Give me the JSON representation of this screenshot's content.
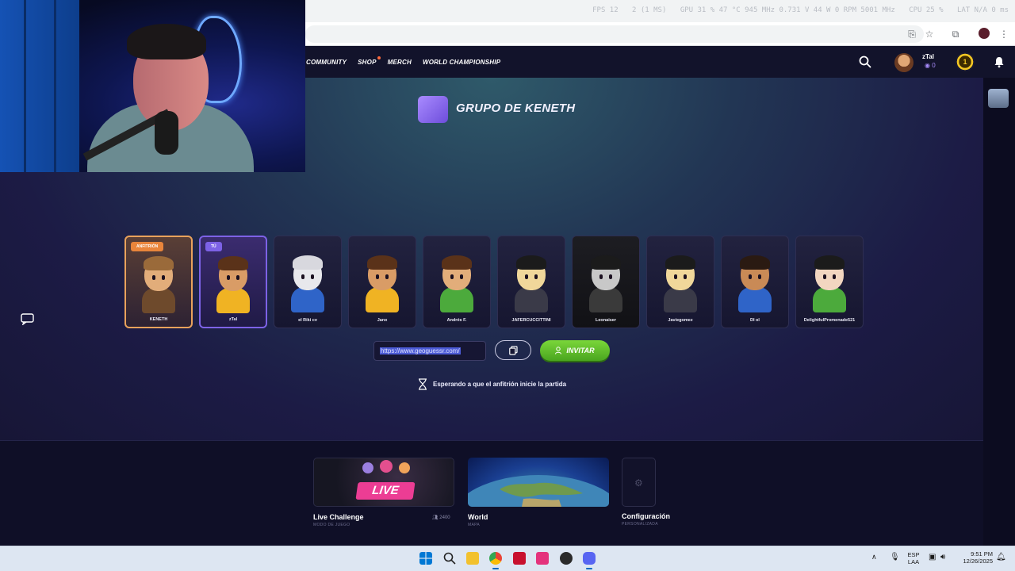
{
  "overlay": {
    "fps": "FPS  12",
    "fps_ms": "2 (1 MS)",
    "gpu": "GPU  31 %  47 °C  945 MHz  0.731 V  44 W  0 RPM  5001 MHz",
    "cpu": "CPU  25 %",
    "lat": "LAT  N/A  0 ms"
  },
  "browser": {
    "icons": [
      "cast-icon",
      "star-icon",
      "extensions-icon",
      "profile-avatar",
      "menu-icon"
    ]
  },
  "nav": {
    "links": [
      {
        "label": "COMMUNITY",
        "notify": false
      },
      {
        "label": "SHOP",
        "notify": true
      },
      {
        "label": "MERCH",
        "notify": false
      },
      {
        "label": "WORLD CHAMPIONSHIP",
        "notify": false
      }
    ],
    "username": "zTal",
    "coins": "0",
    "level": "1"
  },
  "lobby": {
    "title": "GRUPO DE KENETH",
    "players": [
      {
        "name": "KENETH",
        "badge": "ANFITRIÓN",
        "role": "host",
        "shirt": "#6e4a2c",
        "hair": "#9a6a3a",
        "skin": "#e2ad7a"
      },
      {
        "name": "zTal",
        "badge": "TÚ",
        "role": "me",
        "shirt": "#f0b323",
        "hair": "#5a3219",
        "skin": "#d99c66"
      },
      {
        "name": "el Riki cv",
        "badge": "",
        "role": "",
        "shirt": "#2f64c8",
        "hair": "#d8d8de",
        "skin": "#e8e8ec"
      },
      {
        "name": "Janx",
        "badge": "",
        "role": "",
        "shirt": "#f0b323",
        "hair": "#5a3219",
        "skin": "#d99c66"
      },
      {
        "name": "Andrés F.",
        "badge": "",
        "role": "",
        "shirt": "#4caa3c",
        "hair": "#5a3219",
        "skin": "#e2ad7a"
      },
      {
        "name": "JAFERCUCCITTINI",
        "badge": "",
        "role": "",
        "shirt": "#3a3a48",
        "hair": "#1b1b1b",
        "skin": "#f0d79a"
      },
      {
        "name": "Leonaiser",
        "badge": "",
        "role": "dim",
        "shirt": "#3a3a3a",
        "hair": "#1b1b1b",
        "skin": "#c8c8c8"
      },
      {
        "name": "Javiegomez",
        "badge": "",
        "role": "",
        "shirt": "#3a3a48",
        "hair": "#1b1b1b",
        "skin": "#f0d79a"
      },
      {
        "name": "DI ol",
        "badge": "",
        "role": "",
        "shirt": "#2f64c8",
        "hair": "#2a1a12",
        "skin": "#c98a56"
      },
      {
        "name": "DelightfulPromenade521",
        "badge": "",
        "role": "",
        "shirt": "#4caa3c",
        "hair": "#1b1b1b",
        "skin": "#f2d6c0"
      }
    ],
    "invite_link": "https://www.geoguessr.com/",
    "invite_label": "INVITAR",
    "waiting_text": "Esperando a que el anfitrión inicie la partida"
  },
  "modes": [
    {
      "title": "Live Challenge",
      "subtitle": "MODO DE JUEGO",
      "count": "2400",
      "sign": "LIVE"
    },
    {
      "title": "World",
      "subtitle": "MAPA"
    },
    {
      "title": "Configuración",
      "subtitle": "PERSONALIZADA"
    }
  ],
  "taskbar": {
    "lang_top": "ESP",
    "lang_bottom": "LAA",
    "time": "9:51 PM",
    "date": "12/26/2025"
  }
}
